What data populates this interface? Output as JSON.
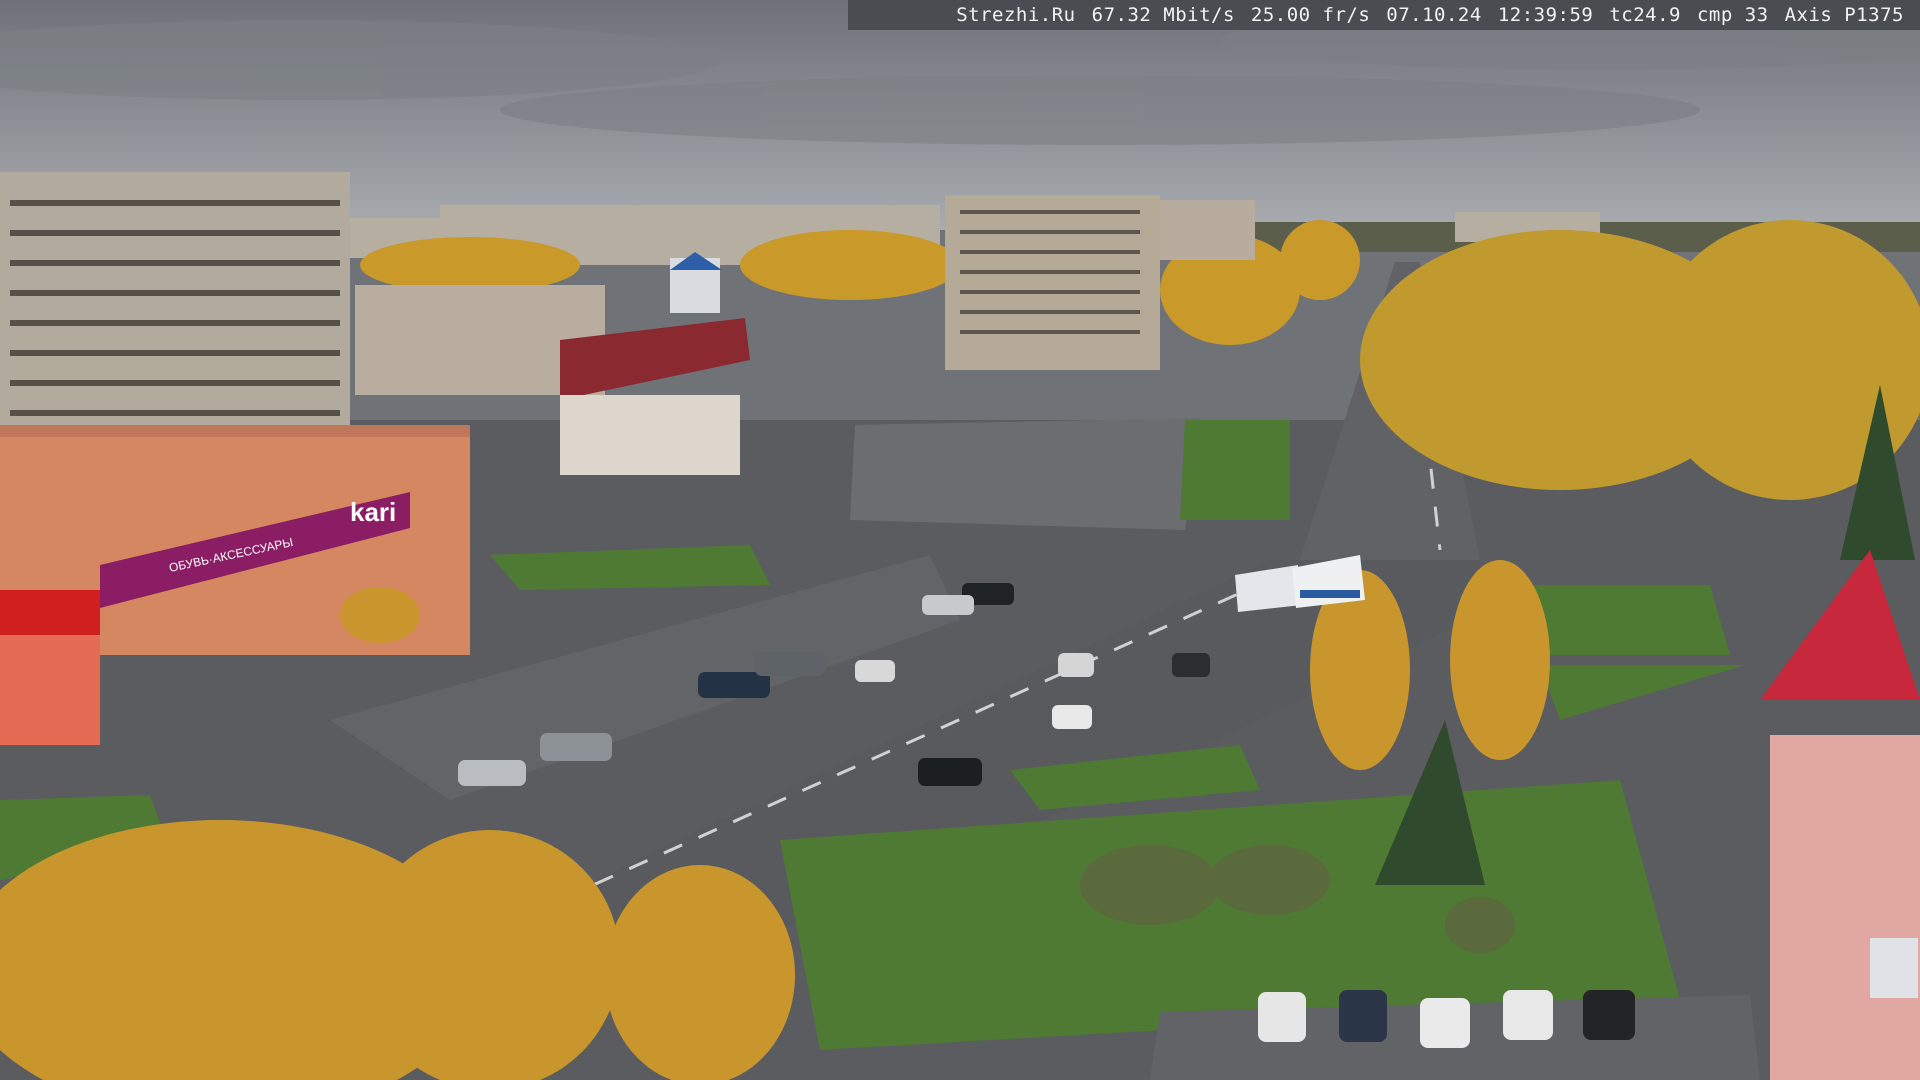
{
  "overlay": {
    "site": "Strezhi.Ru",
    "bitrate": "67.32 Mbit/s",
    "framerate": "25.00 fr/s",
    "date": "07.10.24",
    "time": "12:39:59",
    "tc": "tc24.9",
    "cmp": "cmp 33",
    "camera": "Axis P1375"
  },
  "signs": {
    "store": "kari",
    "store_sub": "ОБУВЬ·АКСЕССУАРЫ"
  },
  "colors": {
    "sky": "#8a8e94",
    "foliage": "#d2a12a",
    "grass": "#4e7a34",
    "asphalt": "#5f6064",
    "store_band": "#8a1d63"
  }
}
